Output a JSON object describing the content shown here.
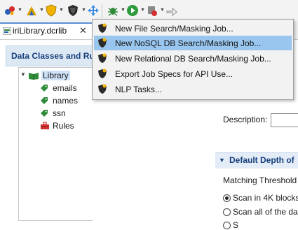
{
  "toolbar": {
    "buttons": [
      "run-icon",
      "stats-icon",
      "shield-icon",
      "mask-job-icon",
      "move-icon",
      "debug-icon",
      "play-icon",
      "deploy-icon",
      "link-icon"
    ]
  },
  "editor_tab": {
    "label": "iriLibrary.dcrlib",
    "close": "✕"
  },
  "left_panel": {
    "title": "Data Classes and Rules",
    "tree": {
      "root": "Library",
      "classes": [
        "emails",
        "names",
        "ssn"
      ],
      "rules": "Rules"
    }
  },
  "right_panel": {
    "description_label": "Description:",
    "section_title": "Default Depth of",
    "matching_label": "Matching Threshold",
    "radio_1": "Scan in 4K blocks",
    "radio_2": "Scan all of the dat",
    "radio_3": "S"
  },
  "menu": {
    "items": [
      "New File Search/Masking Job...",
      "New NoSQL DB Search/Masking Job...",
      "New Relational DB Search/Masking Job...",
      "Export Job Specs for API Use...",
      "NLP Tasks..."
    ],
    "highlighted_index": 1
  },
  "colors": {
    "highlight": "#99c6ee",
    "panel_title": "#163f7a",
    "tag_green": "#2e8b3a"
  }
}
